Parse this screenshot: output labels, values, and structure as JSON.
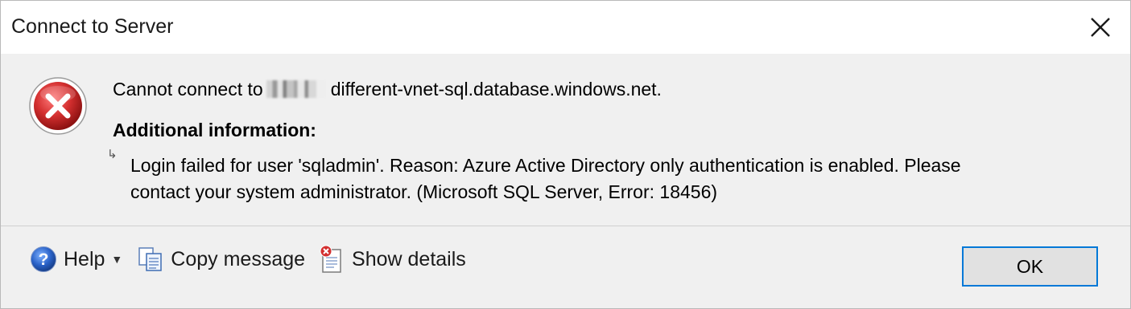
{
  "window": {
    "title": "Connect to Server",
    "close_icon": "close-icon"
  },
  "message": {
    "icon": "error-icon",
    "prefix": "Cannot connect to",
    "server": "different-vnet-sql.database.windows.net.",
    "additional_heading": "Additional information:",
    "detail_lines": [
      "Login failed for user 'sqladmin'. Reason: Azure Active Directory only authentication is enabled. Please",
      "contact your system administrator. (Microsoft SQL Server, Error: 18456)"
    ]
  },
  "toolbar": {
    "help_label": "Help",
    "copy_label": "Copy message",
    "details_label": "Show details"
  },
  "buttons": {
    "ok_label": "OK"
  },
  "colors": {
    "accent": "#0078d7",
    "error_red": "#d32f2f",
    "background": "#f0f0f0"
  }
}
